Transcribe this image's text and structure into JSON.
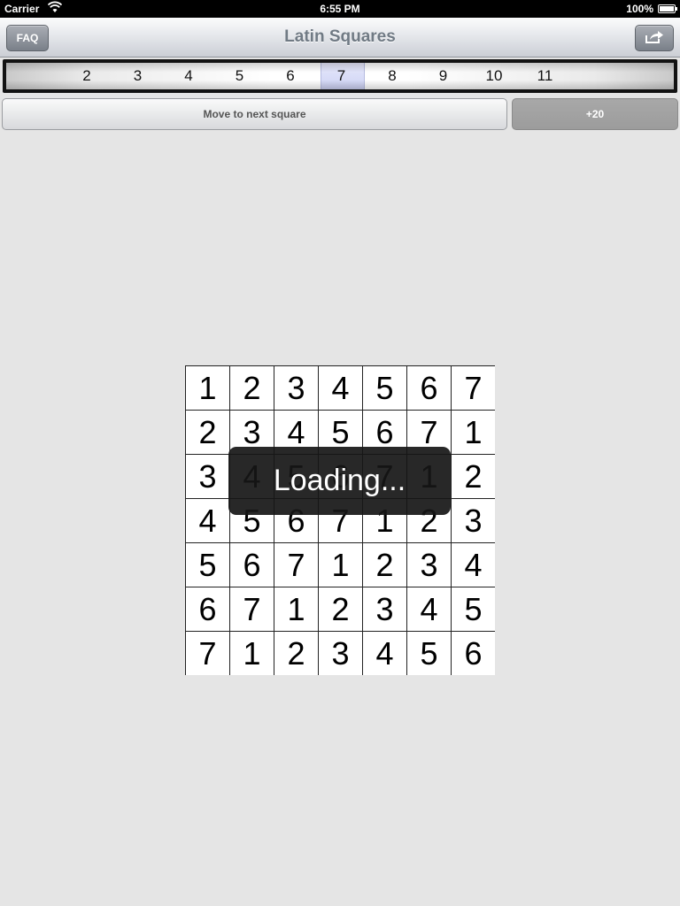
{
  "status_bar": {
    "carrier": "Carrier",
    "time": "6:55 PM",
    "battery": "100%"
  },
  "nav": {
    "title": "Latin Squares",
    "faq_label": "FAQ",
    "share_icon": "share-icon"
  },
  "picker": {
    "items": [
      "2",
      "3",
      "4",
      "5",
      "6",
      "7",
      "8",
      "9",
      "10",
      "11"
    ],
    "selected": "7"
  },
  "actions": {
    "next_label": "Move to next square",
    "plus_label": "+20"
  },
  "grid": {
    "rows": [
      [
        "1",
        "2",
        "3",
        "4",
        "5",
        "6",
        "7"
      ],
      [
        "2",
        "3",
        "4",
        "5",
        "6",
        "7",
        "1"
      ],
      [
        "3",
        "4",
        "5",
        "6",
        "7",
        "1",
        "2"
      ],
      [
        "4",
        "5",
        "6",
        "7",
        "1",
        "2",
        "3"
      ],
      [
        "5",
        "6",
        "7",
        "1",
        "2",
        "3",
        "4"
      ],
      [
        "6",
        "7",
        "1",
        "2",
        "3",
        "4",
        "5"
      ],
      [
        "7",
        "1",
        "2",
        "3",
        "4",
        "5",
        "6"
      ]
    ]
  },
  "overlay": {
    "loading_text": "Loading..."
  }
}
